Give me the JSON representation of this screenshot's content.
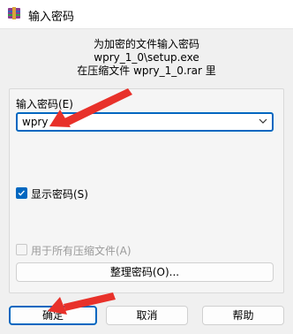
{
  "window": {
    "title": "输入密码"
  },
  "info": {
    "line1": "为加密的文件输入密码",
    "line2": "wpry_1_0\\setup.exe",
    "line3": "在压缩文件 wpry_1_0.rar 里"
  },
  "password": {
    "label": "输入密码(E)",
    "value": "wpry"
  },
  "options": {
    "show_password": {
      "label": "显示密码(S)",
      "checked": true
    },
    "use_for_all": {
      "label": "用于所有压缩文件(A)",
      "checked": false,
      "disabled": true
    }
  },
  "buttons": {
    "organize": "整理密码(O)...",
    "ok": "确定",
    "cancel": "取消",
    "help": "帮助"
  },
  "colors": {
    "accent": "#0067c0",
    "annotation_arrow": "#e8312a"
  },
  "icons": {
    "app": "winrar-archive-icon",
    "dropdown": "chevron-down-icon",
    "check": "checkmark-icon"
  }
}
